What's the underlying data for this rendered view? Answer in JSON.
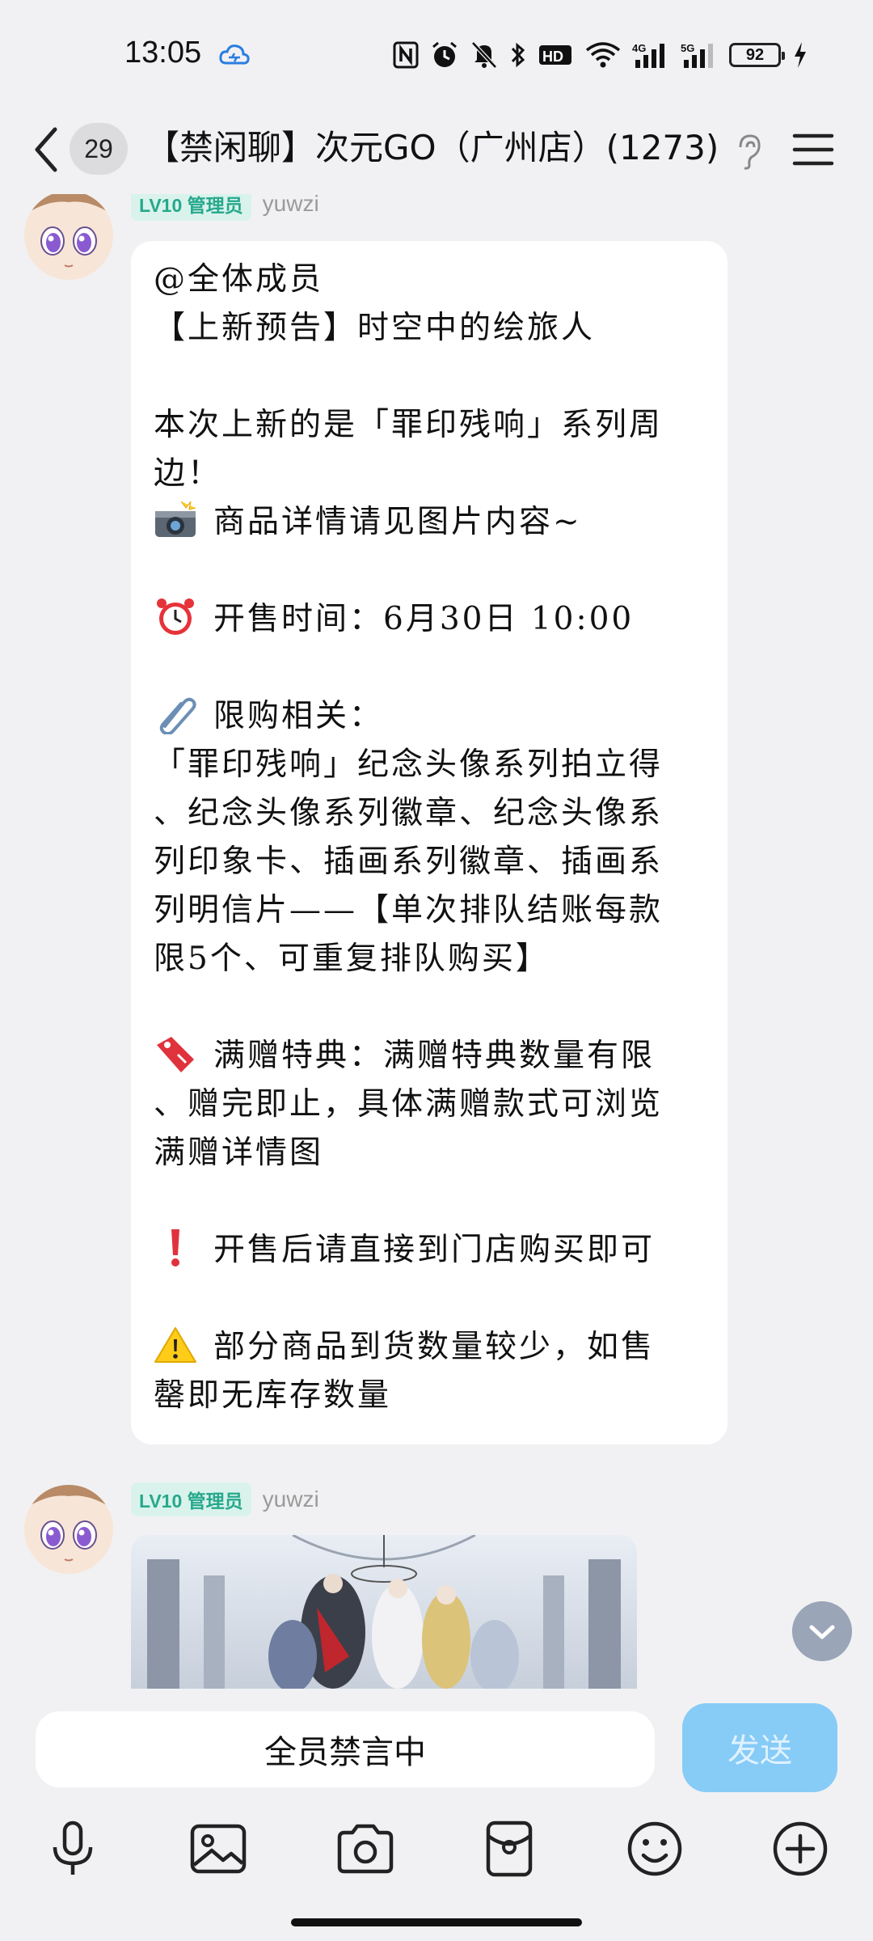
{
  "status_bar": {
    "time": "13:05",
    "battery": "92",
    "icons": [
      "cloud-sync-icon",
      "nfc-icon",
      "alarm-icon",
      "mute-icon",
      "bluetooth-icon",
      "hd-icon",
      "wifi-icon",
      "signal-4g-icon",
      "signal-5g-icon",
      "battery-icon",
      "charging-icon"
    ]
  },
  "header": {
    "unread_count": "29",
    "title": "【禁闲聊】次元GO（广州店）(1273)"
  },
  "messages": [
    {
      "level": "LV10",
      "role": "管理员",
      "sender": "yuwzi",
      "lines": [
        {
          "emoji": "",
          "text": "@全体成员"
        },
        {
          "emoji": "",
          "text": "【上新预告】时空中的绘旅人"
        },
        {
          "emoji": "",
          "text": ""
        },
        {
          "emoji": "",
          "text": "本次上新的是「罪印残响」系列周"
        },
        {
          "emoji": "",
          "text": "边！"
        },
        {
          "emoji": "camera-flash-emoji",
          "text": "商品详情请见图片内容~"
        },
        {
          "emoji": "",
          "text": ""
        },
        {
          "emoji": "alarm-clock-emoji",
          "text": "开售时间：6月30日 10:00"
        },
        {
          "emoji": "",
          "text": ""
        },
        {
          "emoji": "paperclip-emoji",
          "text": "限购相关："
        },
        {
          "emoji": "",
          "text": "「罪印残响」纪念头像系列拍立得"
        },
        {
          "emoji": "",
          "text": "、纪念头像系列徽章、纪念头像系"
        },
        {
          "emoji": "",
          "text": "列印象卡、插画系列徽章、插画系"
        },
        {
          "emoji": "",
          "text": "列明信片——【单次排队结账每款"
        },
        {
          "emoji": "",
          "text": "限5个、可重复排队购买】"
        },
        {
          "emoji": "",
          "text": ""
        },
        {
          "emoji": "bookmark-emoji",
          "text": "满赠特典：满赠特典数量有限"
        },
        {
          "emoji": "",
          "text": "、赠完即止，具体满赠款式可浏览"
        },
        {
          "emoji": "",
          "text": "满赠详情图"
        },
        {
          "emoji": "",
          "text": ""
        },
        {
          "emoji": "exclamation-emoji",
          "text": "开售后请直接到门店购买即可"
        },
        {
          "emoji": "",
          "text": ""
        },
        {
          "emoji": "warning-emoji",
          "text": "部分商品到货数量较少，如售"
        },
        {
          "emoji": "",
          "text": "罄即无库存数量"
        }
      ]
    },
    {
      "level": "LV10",
      "role": "管理员",
      "sender": "yuwzi",
      "image": "illustration-image"
    }
  ],
  "input": {
    "mute_text": "全员禁言中",
    "send_label": "发送"
  },
  "toolbar": [
    "microphone-icon",
    "image-icon",
    "camera-icon",
    "red-packet-icon",
    "emoji-icon",
    "plus-icon"
  ],
  "colors": {
    "background": "#f1f1f3",
    "send_button": "#87cbf7",
    "level_badge": "#27a88c"
  }
}
